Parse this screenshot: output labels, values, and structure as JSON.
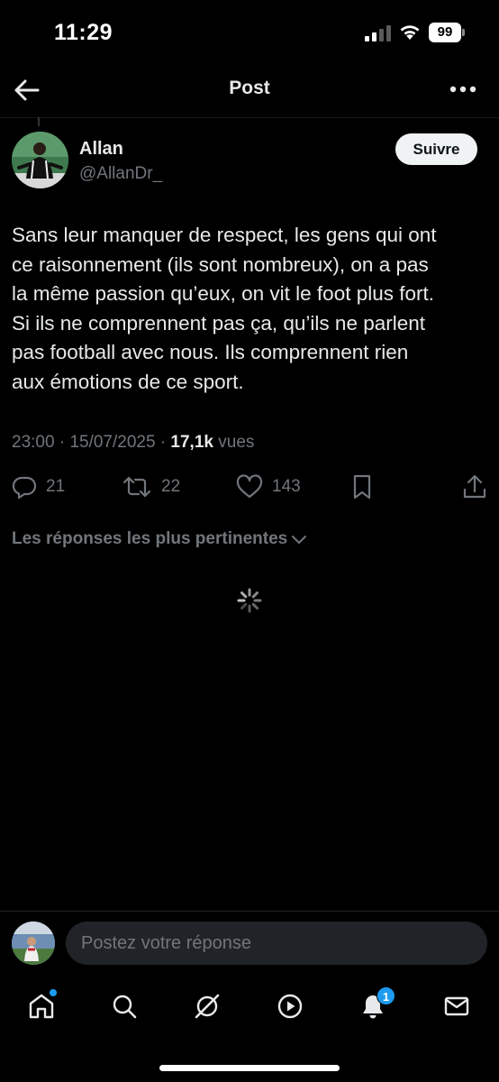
{
  "status_bar": {
    "time": "11:29",
    "battery": "99"
  },
  "header": {
    "title": "Post"
  },
  "author": {
    "name": "Allan",
    "handle": "@AllanDr_",
    "follow_label": "Suivre"
  },
  "post": {
    "lines": [
      "Sans leur manquer de respect, les gens qui ont",
      "ce raisonnement (ils sont nombreux), on a pas",
      "la même passion qu’eux, on vit le foot plus fort.",
      "Si ils ne comprennent pas ça, qu’ils ne parlent",
      "pas football avec nous. Ils comprennent rien",
      "aux émotions de ce sport."
    ],
    "time": "23:00",
    "date": "15/07/2025",
    "separator": "·",
    "views_count": "17,1k",
    "views_label": "vues"
  },
  "actions": {
    "replies": "21",
    "reposts": "22",
    "likes": "143"
  },
  "relevant_replies_label": "Les réponses les plus pertinentes",
  "composer": {
    "placeholder": "Postez votre réponse"
  },
  "tab_bar": {
    "items": [
      "home-icon",
      "search-icon",
      "grok-icon",
      "video-icon",
      "notifications-icon",
      "messages-icon"
    ],
    "notification_count": "1"
  },
  "colors": {
    "accent": "#1d9bf0",
    "muted": "#71767b",
    "text": "#e7e9ea",
    "background": "#000000"
  }
}
